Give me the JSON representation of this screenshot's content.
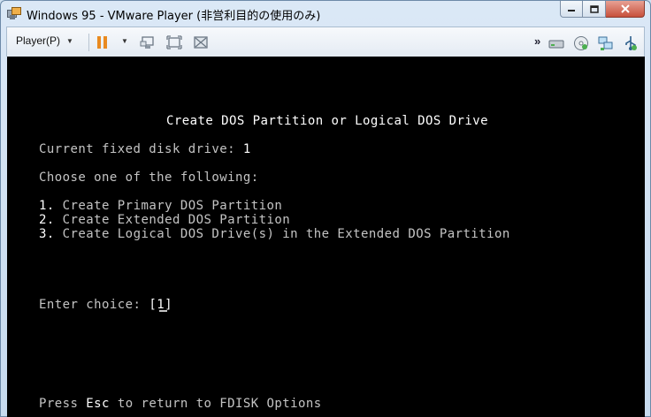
{
  "window": {
    "title": "Windows 95 - VMware Player (非営利目的の使用のみ)",
    "icon": "vmware-icon",
    "minimize_icon": "minimize-icon",
    "maximize_icon": "maximize-icon",
    "close_icon": "close-icon"
  },
  "toolbar": {
    "player_menu_label": "Player(P)",
    "player_menu_icon": "chevron-down-icon",
    "pause_icon": "pause-icon",
    "send_ctrl_alt_del_icon": "ctrl-alt-del-icon",
    "fullscreen_icon": "fullscreen-icon",
    "unity_icon": "unity-icon",
    "overflow_icon": "double-chevron-icon",
    "device_icons": [
      "hard-disk-icon",
      "cd-drive-icon",
      "network-adapter-icon",
      "usb-icon"
    ]
  },
  "console": {
    "heading": "Create DOS Partition or Logical DOS Drive",
    "current_drive_label": "Current fixed disk drive:",
    "current_drive_value": "1",
    "choose_prompt": "Choose one of the following:",
    "options": [
      {
        "num": "1.",
        "label": "Create Primary DOS Partition"
      },
      {
        "num": "2.",
        "label": "Create Extended DOS Partition"
      },
      {
        "num": "3.",
        "label": "Create Logical DOS Drive(s) in the Extended DOS Partition"
      }
    ],
    "enter_choice_label": "Enter choice:",
    "choice_open": "[",
    "choice_value": "1",
    "choice_close": "]",
    "footer_prefix": "Press",
    "footer_key": "Esc",
    "footer_suffix": "to return to FDISK Options"
  },
  "colors": {
    "console_bg": "#000000",
    "console_text": "#c4c4c4",
    "console_bright": "#ffffff",
    "pause_accent": "#e98a20"
  }
}
